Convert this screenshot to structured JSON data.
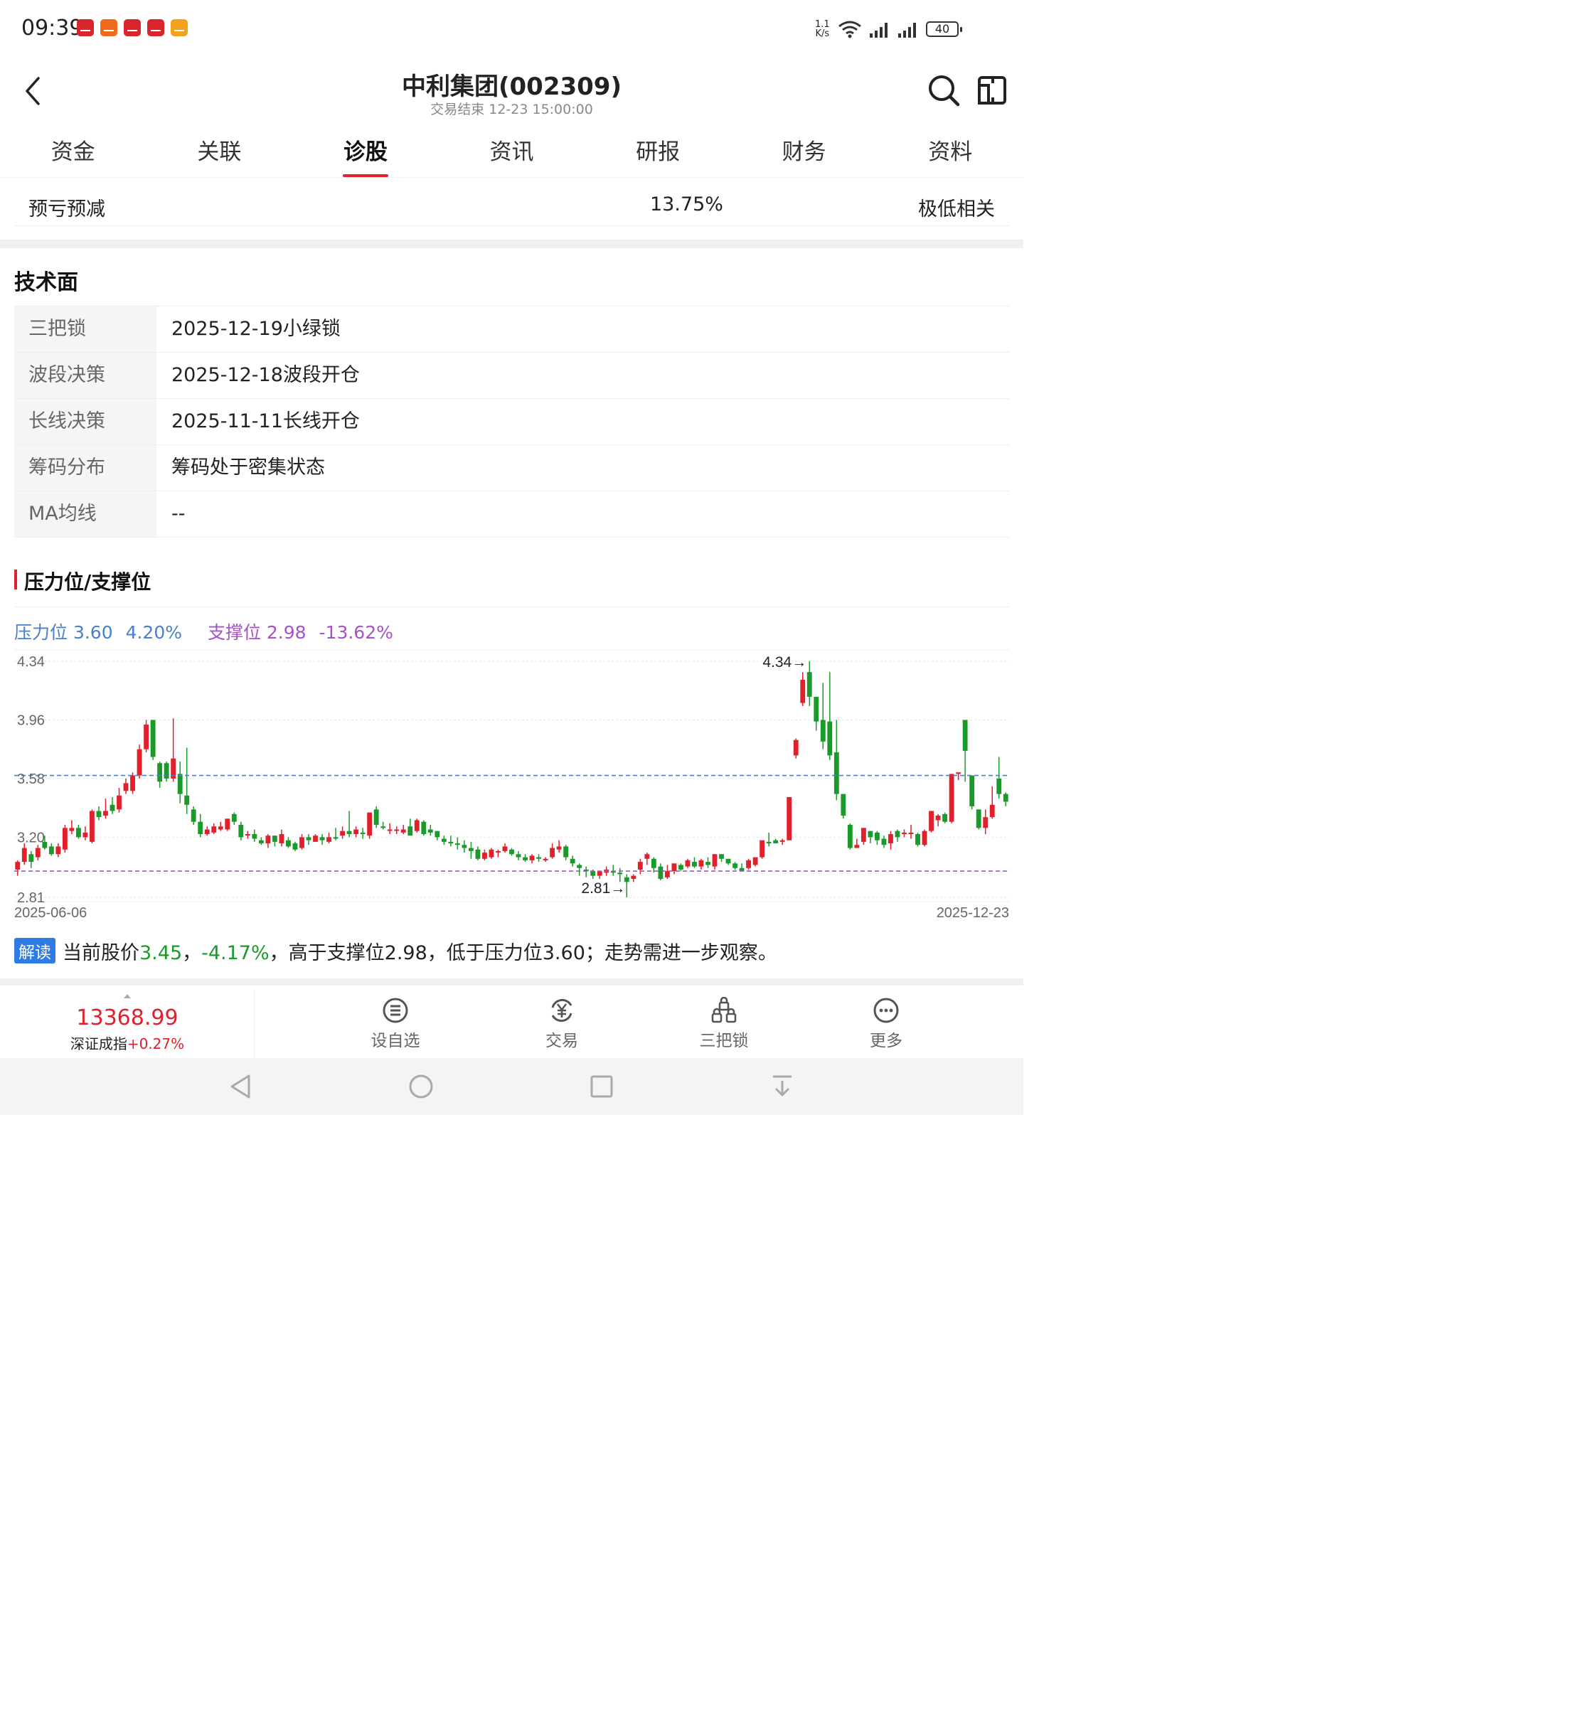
{
  "status": {
    "time": "09:39",
    "net_speed_top": "1.1",
    "net_speed_unit": "K/s",
    "battery": "40"
  },
  "header": {
    "title": "中利集团(002309)",
    "subtitle": "交易结束 12-23 15:00:00"
  },
  "tabs": [
    {
      "label": "资金"
    },
    {
      "label": "关联"
    },
    {
      "label": "诊股"
    },
    {
      "label": "资讯"
    },
    {
      "label": "研报"
    },
    {
      "label": "财务"
    },
    {
      "label": "资料"
    }
  ],
  "forecast": {
    "type": "预亏预减",
    "percent": "13.75%",
    "relation": "极低相关"
  },
  "technical": {
    "title": "技术面",
    "rows": [
      {
        "label": "三把锁",
        "value": "2025-12-19小绿锁"
      },
      {
        "label": "波段决策",
        "value": "2025-12-18波段开仓"
      },
      {
        "label": "长线决策",
        "value": "2025-11-11长线开仓"
      },
      {
        "label": "筹码分布",
        "value": "筹码处于密集状态"
      },
      {
        "label": "MA均线",
        "value": "--"
      }
    ]
  },
  "support": {
    "title": "压力位/支撑位",
    "pressure_label": "压力位 3.60",
    "pressure_pct": "4.20%",
    "support_label": "支撑位 2.98",
    "support_pct": "-13.62%"
  },
  "chart_data": {
    "type": "candlestick",
    "x_start": "2025-06-06",
    "x_end": "2025-12-23",
    "y_ticks": [
      "4.34",
      "3.96",
      "3.58",
      "3.20",
      "2.81"
    ],
    "ylim": [
      2.81,
      4.34
    ],
    "pressure_line": 3.6,
    "support_line": 2.98,
    "max_marker": "4.34→",
    "min_marker": "2.81→",
    "colors": {
      "up": "#e0212b",
      "down": "#1a9a2a",
      "pressure": "#4a7fc9",
      "support": "#a453c8"
    },
    "candles": [
      [
        2.99,
        3.04,
        2.95,
        3.05
      ],
      [
        3.04,
        3.13,
        3.02,
        3.16
      ],
      [
        3.09,
        3.04,
        3.0,
        3.11
      ],
      [
        3.07,
        3.13,
        3.05,
        3.15
      ],
      [
        3.17,
        3.13,
        3.12,
        3.21
      ],
      [
        3.14,
        3.09,
        3.08,
        3.16
      ],
      [
        3.09,
        3.14,
        3.07,
        3.16
      ],
      [
        3.12,
        3.26,
        3.1,
        3.28
      ],
      [
        3.24,
        3.26,
        3.22,
        3.31
      ],
      [
        3.26,
        3.2,
        3.19,
        3.28
      ],
      [
        3.2,
        3.23,
        3.18,
        3.27
      ],
      [
        3.17,
        3.37,
        3.16,
        3.38
      ],
      [
        3.37,
        3.33,
        3.31,
        3.4
      ],
      [
        3.34,
        3.37,
        3.32,
        3.45
      ],
      [
        3.41,
        3.37,
        3.35,
        3.46
      ],
      [
        3.38,
        3.47,
        3.36,
        3.52
      ],
      [
        3.5,
        3.55,
        3.48,
        3.58
      ],
      [
        3.5,
        3.6,
        3.48,
        3.62
      ],
      [
        3.6,
        3.77,
        3.58,
        3.8
      ],
      [
        3.77,
        3.93,
        3.75,
        3.96
      ],
      [
        3.96,
        3.72,
        3.7,
        3.96
      ],
      [
        3.68,
        3.56,
        3.52,
        3.69
      ],
      [
        3.68,
        3.58,
        3.56,
        3.69
      ],
      [
        3.58,
        3.71,
        3.56,
        3.97
      ],
      [
        3.61,
        3.48,
        3.42,
        3.69
      ],
      [
        3.47,
        3.41,
        3.35,
        3.78
      ],
      [
        3.38,
        3.3,
        3.28,
        3.4
      ],
      [
        3.3,
        3.22,
        3.2,
        3.35
      ],
      [
        3.22,
        3.25,
        3.21,
        3.27
      ],
      [
        3.23,
        3.27,
        3.22,
        3.29
      ],
      [
        3.25,
        3.27,
        3.24,
        3.3
      ],
      [
        3.25,
        3.32,
        3.24,
        3.32
      ],
      [
        3.35,
        3.3,
        3.28,
        3.36
      ],
      [
        3.28,
        3.2,
        3.18,
        3.3
      ],
      [
        3.22,
        3.22,
        3.19,
        3.24
      ],
      [
        3.22,
        3.19,
        3.17,
        3.25
      ],
      [
        3.18,
        3.16,
        3.15,
        3.2
      ],
      [
        3.16,
        3.21,
        3.13,
        3.22
      ],
      [
        3.21,
        3.17,
        3.14,
        3.21
      ],
      [
        3.16,
        3.22,
        3.14,
        3.25
      ],
      [
        3.18,
        3.14,
        3.13,
        3.2
      ],
      [
        3.16,
        3.12,
        3.11,
        3.17
      ],
      [
        3.13,
        3.2,
        3.12,
        3.22
      ],
      [
        3.2,
        3.18,
        3.15,
        3.22
      ],
      [
        3.17,
        3.21,
        3.17,
        3.22
      ],
      [
        3.2,
        3.18,
        3.15,
        3.22
      ],
      [
        3.17,
        3.2,
        3.16,
        3.23
      ],
      [
        3.2,
        3.19,
        3.18,
        3.26
      ],
      [
        3.21,
        3.24,
        3.19,
        3.27
      ],
      [
        3.24,
        3.22,
        3.2,
        3.37
      ],
      [
        3.22,
        3.25,
        3.2,
        3.27
      ],
      [
        3.23,
        3.22,
        3.19,
        3.26
      ],
      [
        3.21,
        3.36,
        3.19,
        3.36
      ],
      [
        3.38,
        3.28,
        3.26,
        3.4
      ],
      [
        3.27,
        3.26,
        3.25,
        3.3
      ],
      [
        3.25,
        3.25,
        3.22,
        3.29
      ],
      [
        3.25,
        3.25,
        3.22,
        3.27
      ],
      [
        3.23,
        3.25,
        3.22,
        3.28
      ],
      [
        3.27,
        3.21,
        3.21,
        3.32
      ],
      [
        3.24,
        3.31,
        3.23,
        3.32
      ],
      [
        3.3,
        3.22,
        3.21,
        3.31
      ],
      [
        3.25,
        3.23,
        3.21,
        3.28
      ],
      [
        3.24,
        3.2,
        3.18,
        3.24
      ],
      [
        3.19,
        3.17,
        3.15,
        3.21
      ],
      [
        3.17,
        3.16,
        3.14,
        3.21
      ],
      [
        3.16,
        3.15,
        3.12,
        3.2
      ],
      [
        3.15,
        3.13,
        3.1,
        3.18
      ],
      [
        3.13,
        3.11,
        3.06,
        3.17
      ],
      [
        3.12,
        3.06,
        3.05,
        3.14
      ],
      [
        3.06,
        3.1,
        3.05,
        3.12
      ],
      [
        3.07,
        3.12,
        3.06,
        3.13
      ],
      [
        3.11,
        3.11,
        3.07,
        3.12
      ],
      [
        3.11,
        3.14,
        3.1,
        3.16
      ],
      [
        3.12,
        3.09,
        3.08,
        3.13
      ],
      [
        3.09,
        3.07,
        3.05,
        3.11
      ],
      [
        3.07,
        3.05,
        3.04,
        3.09
      ],
      [
        3.05,
        3.08,
        3.03,
        3.09
      ],
      [
        3.07,
        3.06,
        3.04,
        3.09
      ],
      [
        3.05,
        3.06,
        3.04,
        3.07
      ],
      [
        3.07,
        3.13,
        3.06,
        3.16
      ],
      [
        3.12,
        3.14,
        3.1,
        3.18
      ],
      [
        3.14,
        3.07,
        3.05,
        3.15
      ],
      [
        3.06,
        3.03,
        3.01,
        3.08
      ],
      [
        3.02,
        3.0,
        2.95,
        3.03
      ],
      [
        2.99,
        2.98,
        2.94,
        3.01
      ],
      [
        2.98,
        2.95,
        2.93,
        2.99
      ],
      [
        2.95,
        2.98,
        2.93,
        2.98
      ],
      [
        2.97,
        2.99,
        2.95,
        3.01
      ],
      [
        2.98,
        2.97,
        2.95,
        3.02
      ],
      [
        2.97,
        2.96,
        2.91,
        3.0
      ],
      [
        2.94,
        2.91,
        2.81,
        2.96
      ],
      [
        2.93,
        2.95,
        2.91,
        2.96
      ],
      [
        2.99,
        3.04,
        2.96,
        3.06
      ],
      [
        3.06,
        3.09,
        3.02,
        3.1
      ],
      [
        3.06,
        3.0,
        2.97,
        3.07
      ],
      [
        3.01,
        2.93,
        2.92,
        3.03
      ],
      [
        2.94,
        2.98,
        2.93,
        3.02
      ],
      [
        2.98,
        3.03,
        2.96,
        3.03
      ],
      [
        3.02,
        2.99,
        2.98,
        3.03
      ],
      [
        3.01,
        3.05,
        3.0,
        3.06
      ],
      [
        3.04,
        3.01,
        3.0,
        3.07
      ],
      [
        3.01,
        3.05,
        2.99,
        3.06
      ],
      [
        3.04,
        3.02,
        3.0,
        3.07
      ],
      [
        3.01,
        3.09,
        2.99,
        3.09
      ],
      [
        3.09,
        3.06,
        3.04,
        3.09
      ],
      [
        3.06,
        3.03,
        3.02,
        3.06
      ],
      [
        3.03,
        3.0,
        2.99,
        3.04
      ],
      [
        3.0,
        2.98,
        2.98,
        3.03
      ],
      [
        3.0,
        3.05,
        2.99,
        3.06
      ],
      [
        3.02,
        3.07,
        3.01,
        3.07
      ],
      [
        3.07,
        3.18,
        3.06,
        3.18
      ],
      [
        3.17,
        3.16,
        3.14,
        3.23
      ],
      [
        3.18,
        3.16,
        3.16,
        3.19
      ],
      [
        3.17,
        3.18,
        3.15,
        3.19
      ],
      [
        3.18,
        3.46,
        3.18,
        3.46
      ],
      [
        3.73,
        3.83,
        3.71,
        3.84
      ],
      [
        4.07,
        4.22,
        4.05,
        4.27
      ],
      [
        4.27,
        4.11,
        4.05,
        4.34
      ],
      [
        4.11,
        3.95,
        3.89,
        4.11
      ],
      [
        3.96,
        3.82,
        3.77,
        4.2
      ],
      [
        3.95,
        3.73,
        3.7,
        4.27
      ],
      [
        3.75,
        3.48,
        3.44,
        3.96
      ],
      [
        3.48,
        3.34,
        3.32,
        3.48
      ],
      [
        3.28,
        3.13,
        3.12,
        3.29
      ],
      [
        3.13,
        3.15,
        3.13,
        3.19
      ],
      [
        3.17,
        3.26,
        3.15,
        3.26
      ],
      [
        3.24,
        3.2,
        3.16,
        3.24
      ],
      [
        3.23,
        3.18,
        3.15,
        3.24
      ],
      [
        3.19,
        3.15,
        3.13,
        3.21
      ],
      [
        3.16,
        3.22,
        3.12,
        3.24
      ],
      [
        3.24,
        3.2,
        3.17,
        3.25
      ],
      [
        3.22,
        3.23,
        3.2,
        3.25
      ],
      [
        3.22,
        3.23,
        3.19,
        3.28
      ],
      [
        3.22,
        3.15,
        3.14,
        3.23
      ],
      [
        3.15,
        3.24,
        3.14,
        3.25
      ],
      [
        3.24,
        3.37,
        3.23,
        3.37
      ],
      [
        3.31,
        3.34,
        3.27,
        3.35
      ],
      [
        3.35,
        3.3,
        3.29,
        3.36
      ],
      [
        3.3,
        3.61,
        3.29,
        3.61
      ],
      [
        3.61,
        3.62,
        3.57,
        3.62
      ],
      [
        3.96,
        3.76,
        3.56,
        3.96
      ],
      [
        3.6,
        3.4,
        3.38,
        3.6
      ],
      [
        3.38,
        3.26,
        3.25,
        3.38
      ],
      [
        3.26,
        3.33,
        3.22,
        3.38
      ],
      [
        3.33,
        3.41,
        3.32,
        3.53
      ],
      [
        3.58,
        3.48,
        3.45,
        3.72
      ],
      [
        3.48,
        3.43,
        3.4,
        3.49
      ]
    ]
  },
  "interpretation": {
    "badge": "解读",
    "prefix": "当前股价",
    "price": "3.45",
    "sep1": "，",
    "change": "-4.17%",
    "suffix": "，高于支撑位2.98，低于压力位3.60；走势需进一步观察。"
  },
  "bottom": {
    "index_value": "13368.99",
    "index_name": "深证成指",
    "index_change": "+0.27%",
    "buttons": [
      {
        "label": "设自选",
        "icon": "list-icon"
      },
      {
        "label": "交易",
        "icon": "yen-exchange-icon"
      },
      {
        "label": "三把锁",
        "icon": "lock-icon"
      },
      {
        "label": "更多",
        "icon": "more-icon"
      }
    ]
  }
}
